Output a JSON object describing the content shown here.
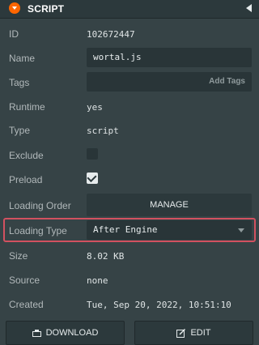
{
  "header": {
    "title": "SCRIPT"
  },
  "rows": {
    "id": {
      "label": "ID",
      "value": "102672447"
    },
    "name": {
      "label": "Name",
      "value": "wortal.js"
    },
    "tags": {
      "label": "Tags",
      "add_label": "Add Tags"
    },
    "runtime": {
      "label": "Runtime",
      "value": "yes"
    },
    "type": {
      "label": "Type",
      "value": "script"
    },
    "exclude": {
      "label": "Exclude",
      "checked": false
    },
    "preload": {
      "label": "Preload",
      "checked": true
    },
    "loading_order": {
      "label": "Loading Order",
      "button": "MANAGE"
    },
    "loading_type": {
      "label": "Loading Type",
      "value": "After Engine"
    },
    "size": {
      "label": "Size",
      "value": "8.02 KB"
    },
    "source": {
      "label": "Source",
      "value": "none"
    },
    "created": {
      "label": "Created",
      "value": "Tue, Sep 20, 2022, 10:51:10"
    }
  },
  "actions": {
    "download": "DOWNLOAD",
    "edit": "EDIT"
  },
  "colors": {
    "accent": "#ff6600",
    "highlight": "#d25160",
    "panel": "#364346"
  }
}
